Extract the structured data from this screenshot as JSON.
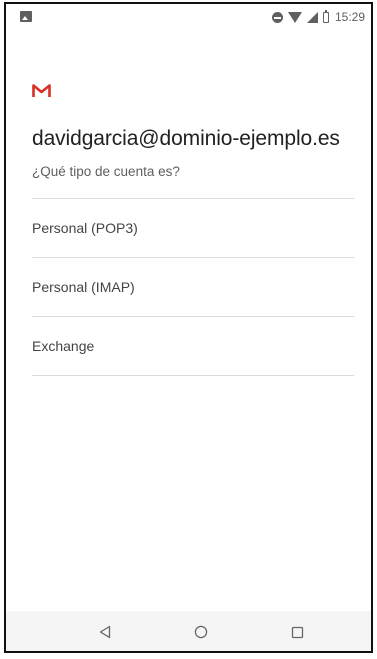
{
  "status_bar": {
    "time": "15:29"
  },
  "account": {
    "email": "davidgarcia@dominio-ejemplo.es",
    "question": "¿Qué tipo de cuenta es?"
  },
  "account_types": [
    {
      "label": "Personal (POP3)"
    },
    {
      "label": "Personal (IMAP)"
    },
    {
      "label": "Exchange"
    }
  ],
  "icons": {
    "status_left": "image-notification-icon",
    "status_right": [
      "do-not-disturb-icon",
      "wifi-icon",
      "signal-icon",
      "battery-icon"
    ],
    "logo": "gmail-logo",
    "navigation": [
      "back-icon",
      "home-icon",
      "recent-apps-icon"
    ]
  },
  "colors": {
    "gmail_red": "#D93025",
    "text_primary": "#212121",
    "text_secondary": "#5F5F5F",
    "divider": "#DCDCDC",
    "nav_background": "#F5F5F5"
  }
}
